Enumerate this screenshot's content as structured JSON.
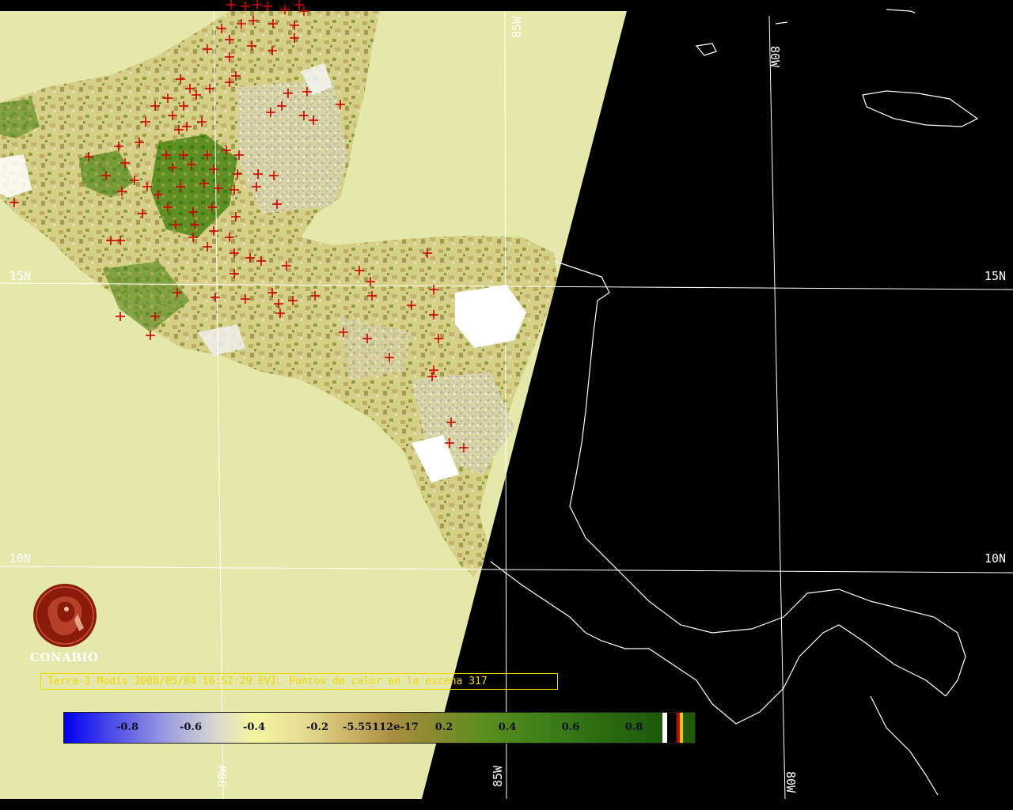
{
  "map": {
    "grid_labels": {
      "lat_15n_left": "15N",
      "lat_15n_right": "15N",
      "lat_10n_left": "10N",
      "lat_10n_right": "10N",
      "lon_85w_top": "85W",
      "lon_80w_top": "80W",
      "lon_90w_bottom": "90W",
      "lon_85w_bottom": "85W",
      "lon_80w_bottom": "80W"
    },
    "colors": {
      "no_data": "#e4e8aa",
      "night_side": "#000000",
      "fire_marker": "#d10000",
      "graticule": "#ffffff",
      "coastline": "#ffffff"
    }
  },
  "logo": {
    "name": "CONABIO",
    "icon": "conabio-seal-icon",
    "color": "#8a1a0a"
  },
  "caption": {
    "text": "Terra-1 Modis 2008/05/04 16:52:29 EVI. Puntos de calor en la escena 317"
  },
  "colorbar": {
    "ticks": [
      "-0.8",
      "-0.6",
      "-0.4",
      "-0.2",
      "-5.55112e-17",
      "0.2",
      "0.4",
      "0.6",
      "0.8"
    ],
    "end_swatches": [
      "#ffffff",
      "#000000",
      "#d10000",
      "#e8d000",
      "#1e5a0c"
    ]
  }
}
